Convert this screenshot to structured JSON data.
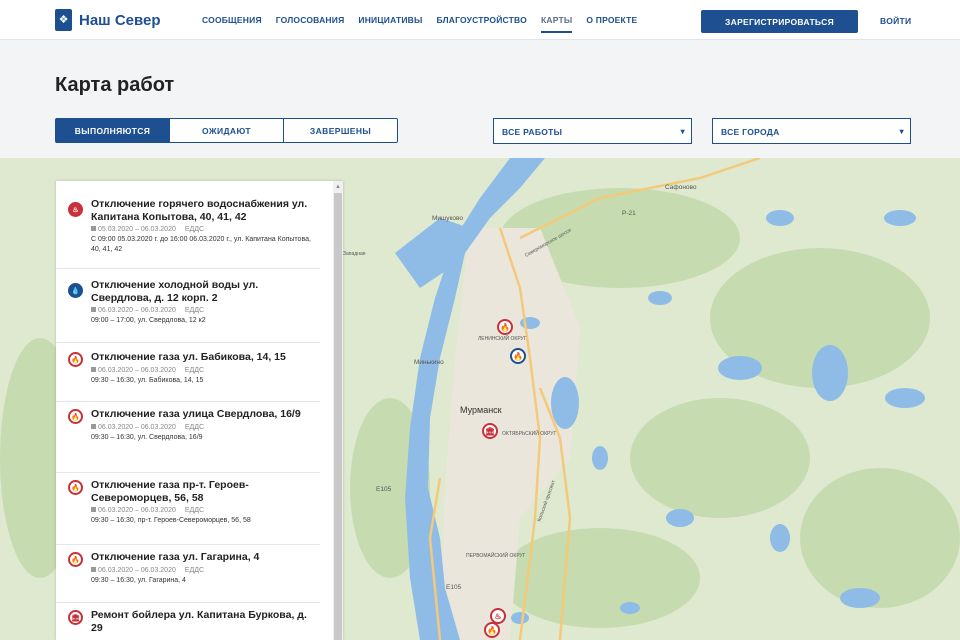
{
  "header": {
    "logo_mark": "❖",
    "brand": "Наш Север",
    "nav": [
      "СООБЩЕНИЯ",
      "ГОЛОСОВАНИЯ",
      "ИНИЦИАТИВЫ",
      "БЛАГОУСТРОЙСТВО",
      "КАРТЫ",
      "О ПРОЕКТЕ"
    ],
    "nav_active": "КАРТЫ",
    "register_label": "ЗАРЕГИСТРИРОВАТЬСЯ",
    "login_label": "ВОЙТИ"
  },
  "page_title": "Карта работ",
  "tabs": [
    "ВЫПОЛНЯЮТСЯ",
    "ОЖИДАЮТ",
    "ЗАВЕРШЕНЫ"
  ],
  "tab_active": "ВЫПОЛНЯЮТСЯ",
  "filters": {
    "works_selected": "ВСЕ РАБОТЫ",
    "cities_selected": "ВСЕ ГОРОДА",
    "caret": "▾"
  },
  "map": {
    "labels": {
      "city": "Мурманск",
      "safonovo": "Сафоново",
      "mishukovo": "Мишуково",
      "minkino": "Минькино",
      "road_r21": "Р-21",
      "road_e105a": "Е105",
      "road_e105b": "Е105",
      "lenin_district": "ЛЕНИНСКИЙ ОКРУГ",
      "oktyabrsky_district": "ОКТЯБРЬСКИЙ ОКРУГ",
      "pervomaisky_district": "ПЕРВОМАЙСКИЙ ОКРУГ",
      "severomorsk_road": "Североморское шоссе",
      "kolsky_ave": "Кольский проспект",
      "western_road": "Западная"
    },
    "colors": {
      "land": "#dfe9d0",
      "forest": "#c6dcb0",
      "water": "#8ebce6",
      "urban": "#ebe6dc",
      "road": "#f3c97a"
    }
  },
  "work_items": [
    {
      "icon": "hot-water-icon",
      "glyph": "♨",
      "title": "Отключение горячего водоснабжения ул. Капитана Копытова, 40, 41, 42",
      "dates": "05.03.2020 – 06.03.2020",
      "author": "ЕДДС",
      "desc": "С 09:00 05.03.2020 г. до 16:00 06.03.2020 г., ул. Капитана Копытова, 40, 41, 42"
    },
    {
      "icon": "cold-water-icon",
      "glyph": "💧",
      "title": "Отключение холодной воды ул. Свердлова, д. 12 корп. 2",
      "dates": "06.03.2020 – 06.03.2020",
      "author": "ЕДДС",
      "desc": "09:00 – 17:00, ул. Свердлова, 12 к2"
    },
    {
      "icon": "gas-icon",
      "glyph": "🔥",
      "title": "Отключение газа ул. Бабикова, 14, 15",
      "dates": "06.03.2020 – 06.03.2020",
      "author": "ЕДДС",
      "desc": "09:30 – 16:30, ул. Бабикова, 14, 15"
    },
    {
      "icon": "gas-icon",
      "glyph": "🔥",
      "title": "Отключение газа улица Свердлова, 16/9",
      "dates": "06.03.2020 – 06.03.2020",
      "author": "ЕДДС",
      "desc": "09:30 – 16:30, ул. Свердлова, 16/9"
    },
    {
      "icon": "gas-icon",
      "glyph": "🔥",
      "title": "Отключение газа пр-т. Героев-Североморцев, 56, 58",
      "dates": "06.03.2020 – 06.03.2020",
      "author": "ЕДДС",
      "desc": "09:30 – 16:30, пр-т. Героев-Североморцев, 56, 58"
    },
    {
      "icon": "gas-icon",
      "glyph": "🔥",
      "title": "Отключение газа ул. Гагарина, 4",
      "dates": "06.03.2020 – 06.03.2020",
      "author": "ЕДДС",
      "desc": "09:30 – 16:30, ул. Гагарина, 4"
    },
    {
      "icon": "building-icon",
      "glyph": "🏛",
      "title": "Ремонт бойлера ул. Капитана Буркова, д. 29",
      "dates": "",
      "author": "",
      "desc": ""
    }
  ]
}
